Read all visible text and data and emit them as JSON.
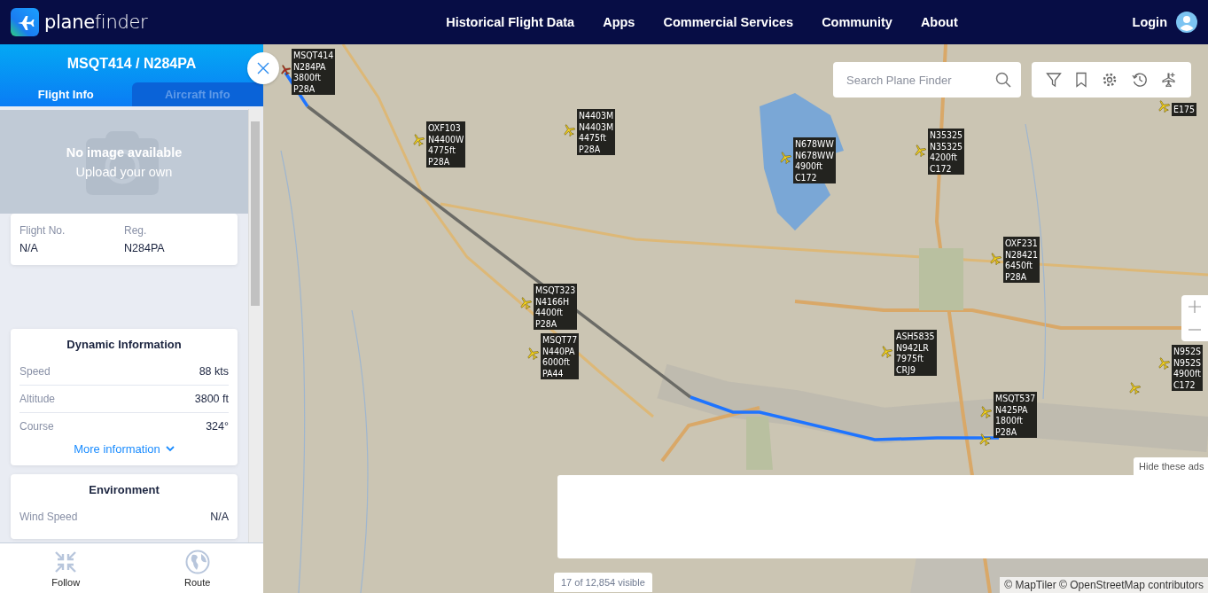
{
  "nav": {
    "brand": "**plane**finder",
    "links": [
      "Historical Flight Data",
      "Apps",
      "Commercial Services",
      "Community",
      "About"
    ],
    "login": "Login"
  },
  "panel": {
    "title": "MSQT414 / N284PA",
    "tabs": [
      {
        "label": "Flight Info",
        "selected": true
      },
      {
        "label": "Aircraft Info",
        "selected": false
      }
    ],
    "photo": {
      "title": "No image available",
      "subtitle": "Upload your own"
    },
    "ids": [
      {
        "label": "Flight No.",
        "value": "N/A"
      },
      {
        "label": "Reg.",
        "value": "N284PA"
      }
    ],
    "dynamic": {
      "title": "Dynamic Information",
      "rows": [
        {
          "label": "Speed",
          "value": "88 kts"
        },
        {
          "label": "Altitude",
          "value": "3800 ft"
        },
        {
          "label": "Course",
          "value": "324°"
        }
      ],
      "more": "More information"
    },
    "environment": {
      "title": "Environment",
      "rows": [
        {
          "label": "Wind Speed",
          "value": "N/A"
        }
      ]
    },
    "actions": [
      {
        "kind": "follow",
        "label": "Follow"
      },
      {
        "kind": "route",
        "label": "Route"
      }
    ]
  },
  "map": {
    "search": {
      "placeholder": "Search Plane Finder"
    },
    "aircraft": [
      {
        "selected": true,
        "lines": [
          "MSQT414",
          "N284PA",
          "3800ft",
          "P28A"
        ]
      },
      {
        "selected": false,
        "lines": [
          "E175"
        ]
      },
      {
        "selected": false,
        "lines": [
          "N4403M",
          "N4403M",
          "4475ft",
          "P28A"
        ]
      },
      {
        "selected": false,
        "lines": [
          "OXF103",
          "N4400W",
          "4775ft",
          "P28A"
        ]
      },
      {
        "selected": false,
        "lines": [
          "N35325",
          "N35325",
          "4200ft",
          "C172"
        ]
      },
      {
        "selected": false,
        "lines": [
          "N678WW",
          "N678WW",
          "4900ft",
          "C172"
        ]
      },
      {
        "selected": false,
        "lines": [
          "OXF231",
          "N28421",
          "6450ft",
          "P28A"
        ]
      },
      {
        "selected": false,
        "lines": [
          "MSQT323",
          "N4166H",
          "4400ft",
          "P28A"
        ]
      },
      {
        "selected": false,
        "lines": [
          "MSQT77",
          "N440PA",
          "6000ft",
          "PA44"
        ]
      },
      {
        "selected": false,
        "lines": [
          "ASH5835",
          "N942LR",
          "7975ft",
          "CRJ9"
        ]
      },
      {
        "selected": false,
        "lines": [
          "N952S",
          "N952S",
          "4900ft",
          "C172"
        ]
      },
      {
        "selected": false
      },
      {
        "selected": false,
        "lines": [
          "MSQT537",
          "N425PA",
          "1800ft",
          "P28A"
        ]
      },
      {
        "selected": false
      }
    ],
    "hide_ads": "Hide these ads",
    "visible_count": "17 of 12,854 visible",
    "attribution": "© MapTiler © OpenStreetMap contributors"
  }
}
